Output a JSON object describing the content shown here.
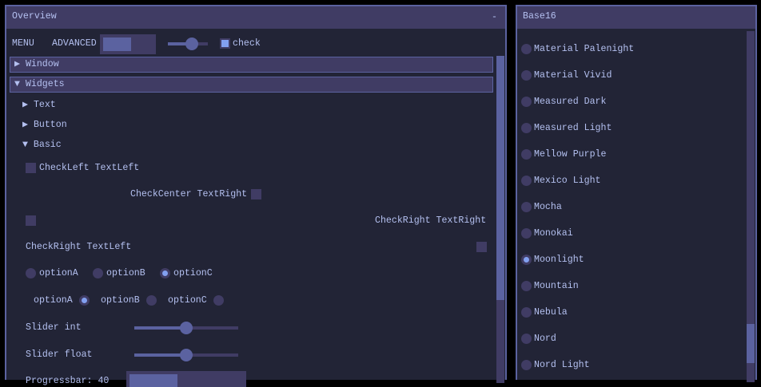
{
  "overview": {
    "title": "Overview",
    "collapse": "-",
    "menu": "MENU",
    "advanced": "ADVANCED",
    "top_slider_fraction": 0.6,
    "check_label": "check",
    "window": "Window",
    "widgets": "Widgets",
    "text": "Text",
    "button": "Button",
    "basic": "Basic",
    "check_left_text_left": "CheckLeft TextLeft",
    "check_center_text_right": "CheckCenter TextRight",
    "check_right_text_right": "CheckRight TextRight",
    "check_right_text_left": "CheckRight TextLeft",
    "options": [
      "optionA",
      "optionB",
      "optionC"
    ],
    "selected_row1": "optionC",
    "selected_row2": "optionA",
    "slider_int": {
      "label": "Slider int",
      "fraction": 0.5
    },
    "slider_float": {
      "label": "Slider float",
      "fraction": 0.5
    },
    "progress": {
      "label": "Progressbar: 40",
      "fraction": 0.4
    }
  },
  "base16": {
    "title": "Base16",
    "selected": "Moonlight",
    "themes": [
      "Material Palenight",
      "Material Vivid",
      "Measured Dark",
      "Measured Light",
      "Mellow Purple",
      "Mexico Light",
      "Mocha",
      "Monokai",
      "Moonlight",
      "Mountain",
      "Nebula",
      "Nord",
      "Nord Light"
    ]
  }
}
